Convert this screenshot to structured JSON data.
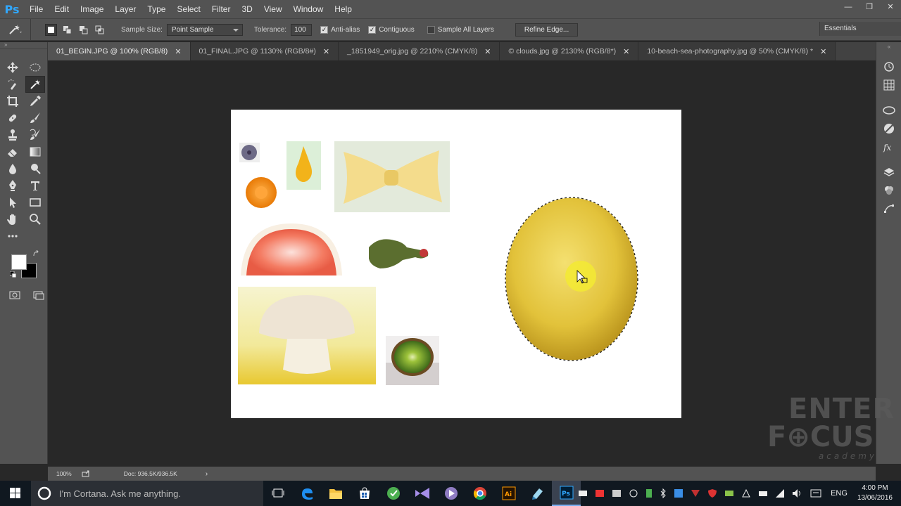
{
  "app": {
    "logo": "Ps"
  },
  "menu": [
    "File",
    "Edit",
    "Image",
    "Layer",
    "Type",
    "Select",
    "Filter",
    "3D",
    "View",
    "Window",
    "Help"
  ],
  "window_controls": {
    "minimize": "—",
    "restore": "❐",
    "close": "✕"
  },
  "options": {
    "sample_size_label": "Sample Size:",
    "sample_size_value": "Point Sample",
    "tolerance_label": "Tolerance:",
    "tolerance_value": "100",
    "anti_alias_label": "Anti-alias",
    "contiguous_label": "Contiguous",
    "sample_all_layers_label": "Sample All Layers",
    "refine_edge_label": "Refine Edge...",
    "workspace": "Essentials"
  },
  "tabs": [
    {
      "label": "01_BEGIN.JPG @ 100% (RGB/8)",
      "active": true
    },
    {
      "label": "01_FINAL.JPG @ 1130% (RGB/8#)"
    },
    {
      "label": "_1851949_orig.jpg @ 2210% (CMYK/8)"
    },
    {
      "label": "© clouds.jpg @ 2130% (RGB/8*)"
    },
    {
      "label": "10-beach-sea-photography.jpg @ 50% (CMYK/8) *"
    }
  ],
  "status": {
    "zoom": "100%",
    "doc": "Doc: 936.5K/936.5K"
  },
  "watermark": {
    "line1": "ENTER",
    "line2": "F⊕CUS",
    "line3": "academy"
  },
  "taskbar": {
    "cortana_placeholder": "I'm Cortana. Ask me anything.",
    "lang": "ENG",
    "time": "4:00 PM",
    "date": "13/06/2016"
  },
  "colors": {
    "ps_blue": "#31a8ff",
    "ui_panel": "#535353",
    "pasteboard": "#282828"
  }
}
